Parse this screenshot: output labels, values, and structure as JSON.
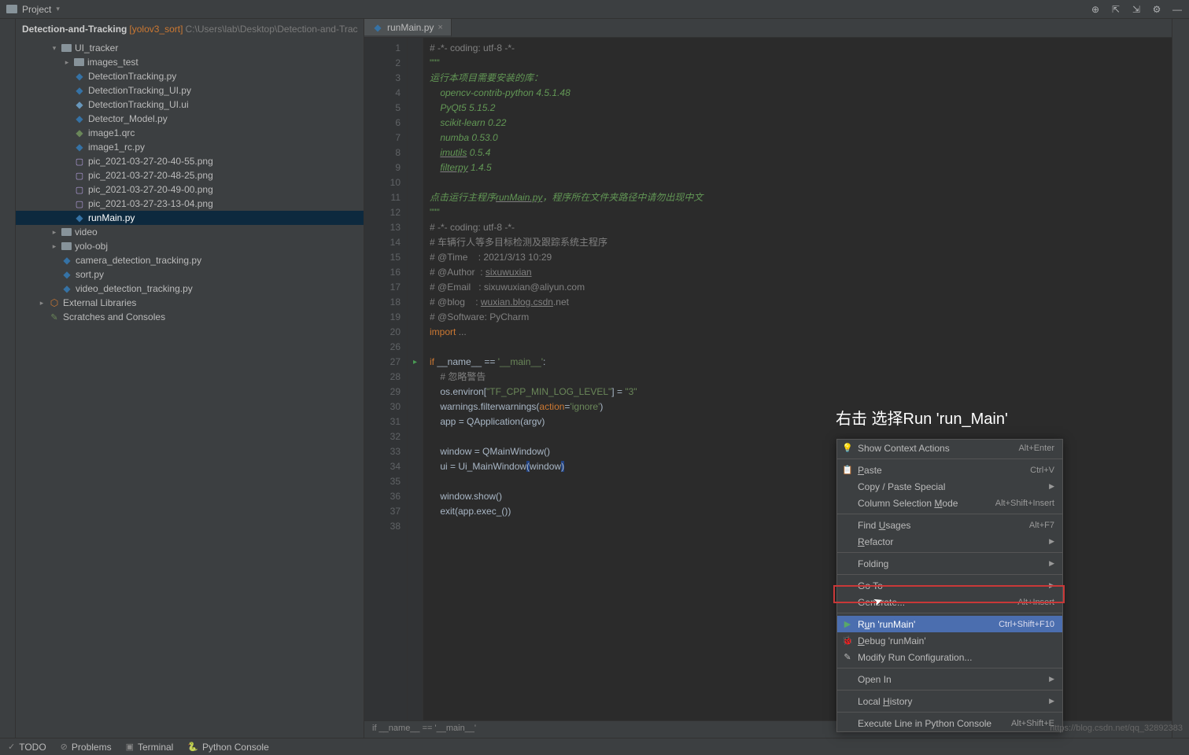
{
  "toolbar": {
    "project_label": "Project",
    "dropdown_arrow": "▾"
  },
  "breadcrumb": {
    "project": "Detection-and-Tracking",
    "branch": "[yolov3_sort]",
    "path": "C:\\Users\\lab\\Desktop\\Detection-and-Trac"
  },
  "tree": [
    {
      "indent": 0,
      "arrow": "▾",
      "icon": "folder",
      "label": "UI_tracker"
    },
    {
      "indent": 1,
      "arrow": "▸",
      "icon": "folder",
      "label": "images_test"
    },
    {
      "indent": 1,
      "arrow": "",
      "icon": "py",
      "label": "DetectionTracking.py"
    },
    {
      "indent": 1,
      "arrow": "",
      "icon": "py",
      "label": "DetectionTracking_UI.py"
    },
    {
      "indent": 1,
      "arrow": "",
      "icon": "ui",
      "label": "DetectionTracking_UI.ui"
    },
    {
      "indent": 1,
      "arrow": "",
      "icon": "py",
      "label": "Detector_Model.py"
    },
    {
      "indent": 1,
      "arrow": "",
      "icon": "qrc",
      "label": "image1.qrc"
    },
    {
      "indent": 1,
      "arrow": "",
      "icon": "py",
      "label": "image1_rc.py"
    },
    {
      "indent": 1,
      "arrow": "",
      "icon": "png",
      "label": "pic_2021-03-27-20-40-55.png"
    },
    {
      "indent": 1,
      "arrow": "",
      "icon": "png",
      "label": "pic_2021-03-27-20-48-25.png"
    },
    {
      "indent": 1,
      "arrow": "",
      "icon": "png",
      "label": "pic_2021-03-27-20-49-00.png"
    },
    {
      "indent": 1,
      "arrow": "",
      "icon": "png",
      "label": "pic_2021-03-27-23-13-04.png"
    },
    {
      "indent": 1,
      "arrow": "",
      "icon": "py",
      "label": "runMain.py",
      "selected": true
    },
    {
      "indent": 0,
      "arrow": "▸",
      "icon": "folder",
      "label": "video"
    },
    {
      "indent": 0,
      "arrow": "▸",
      "icon": "folder",
      "label": "yolo-obj"
    },
    {
      "indent": 0,
      "arrow": "",
      "icon": "py",
      "label": "camera_detection_tracking.py"
    },
    {
      "indent": 0,
      "arrow": "",
      "icon": "py",
      "label": "sort.py"
    },
    {
      "indent": 0,
      "arrow": "",
      "icon": "py",
      "label": "video_detection_tracking.py"
    },
    {
      "indent": -1,
      "arrow": "▸",
      "icon": "lib",
      "label": "External Libraries"
    },
    {
      "indent": -1,
      "arrow": "",
      "icon": "scratch",
      "label": "Scratches and Consoles"
    }
  ],
  "tab": {
    "name": "runMain.py"
  },
  "code": {
    "lines": [
      {
        "n": 1,
        "html": "<span class='c-comment'># -*- coding: utf-8 -*-</span>"
      },
      {
        "n": 2,
        "html": "<span class='docstr'>\"\"\"</span>"
      },
      {
        "n": 3,
        "html": "<span class='c-docline'>运行本项目需要安装的库：</span>"
      },
      {
        "n": 4,
        "html": "<span class='c-docline'>    opencv-contrib-python 4.5.1.48</span>"
      },
      {
        "n": 5,
        "html": "<span class='c-docline'>    PyQt5 5.15.2</span>"
      },
      {
        "n": 6,
        "html": "<span class='c-docline'>    scikit-learn 0.22</span>"
      },
      {
        "n": 7,
        "html": "<span class='c-docline'>    numba 0.53.0</span>"
      },
      {
        "n": 8,
        "html": "<span class='c-docline'>    <span class='c-under'>imutils</span> 0.5.4</span>"
      },
      {
        "n": 9,
        "html": "<span class='c-docline'>    <span class='c-under'>filterpy</span> 1.4.5</span>"
      },
      {
        "n": 10,
        "html": ""
      },
      {
        "n": 11,
        "html": "<span class='c-docline'>点击运行主程序<span class='c-under'>runMain.py</span>，程序所在文件夹路径中请勿出现中文</span>"
      },
      {
        "n": 12,
        "html": "<span class='docstr'>\"\"\"</span>"
      },
      {
        "n": 13,
        "html": "<span class='c-comment'># -*- coding: utf-8 -*-</span>"
      },
      {
        "n": 14,
        "html": "<span class='c-comment'># 车辆行人等多目标检测及跟踪系统主程序</span>"
      },
      {
        "n": 15,
        "html": "<span class='c-comment'># @Time    : 2021/3/13 10:29</span>"
      },
      {
        "n": 16,
        "html": "<span class='c-comment'># @Author  : <span class='c-under'>sixuwuxian</span></span>"
      },
      {
        "n": 17,
        "html": "<span class='c-comment'># @Email   : sixuwuxian@aliyun.com</span>"
      },
      {
        "n": 18,
        "html": "<span class='c-comment'># @blog    : <span class='c-under'>wuxian.blog.csdn</span>.net</span>"
      },
      {
        "n": 19,
        "html": "<span class='c-comment'># @Software: PyCharm</span>"
      },
      {
        "n": 20,
        "html": "<span class='c-keyword'>import </span><span class='c-comment'>...</span>"
      },
      {
        "n": 26,
        "html": ""
      },
      {
        "n": 27,
        "mark": "▸",
        "html": "<span class='c-keyword'>if</span> __name__ == <span class='c-string'>'__main__'</span>:"
      },
      {
        "n": 28,
        "html": "    <span class='c-comment'># 忽略警告</span>"
      },
      {
        "n": 29,
        "html": "    os.environ[<span class='c-string'>\"TF_CPP_MIN_LOG_LEVEL\"</span>] = <span class='c-string'>\"3\"</span>"
      },
      {
        "n": 30,
        "html": "    warnings.filterwarnings(<span class='c-keyword'>action</span>=<span class='c-string'>'ignore'</span>)"
      },
      {
        "n": 31,
        "html": "    app = QApplication(argv)"
      },
      {
        "n": 32,
        "html": ""
      },
      {
        "n": 33,
        "html": "    window = QMainWindow()"
      },
      {
        "n": 34,
        "html": "    ui = Ui_MainWindow<span class='caret-hl'>(</span>window<span class='caret-hl'>)</span>"
      },
      {
        "n": 35,
        "html": ""
      },
      {
        "n": 36,
        "html": "    window.show()"
      },
      {
        "n": 37,
        "html": "    exit(app.exec_())"
      },
      {
        "n": 38,
        "html": ""
      }
    ]
  },
  "bottom_breadcrumb": "if __name__ == '__main__'",
  "context_menu": [
    {
      "icon": "💡",
      "label": "Show Context Actions",
      "shortcut": "Alt+Enter"
    },
    {
      "sep": true
    },
    {
      "icon": "📋",
      "label": "Paste",
      "mnemonic": "P",
      "shortcut": "Ctrl+V"
    },
    {
      "label": "Copy / Paste Special",
      "submenu": true
    },
    {
      "label": "Column Selection Mode",
      "mnemonic": "M",
      "shortcut": "Alt+Shift+Insert"
    },
    {
      "sep": true
    },
    {
      "label": "Find Usages",
      "mnemonic": "U",
      "shortcut": "Alt+F7"
    },
    {
      "label": "Refactor",
      "mnemonic": "R",
      "submenu": true
    },
    {
      "sep": true
    },
    {
      "label": "Folding",
      "submenu": true
    },
    {
      "sep": true
    },
    {
      "label": "Go To",
      "submenu": true
    },
    {
      "label": "Generate...",
      "shortcut": "Alt+Insert"
    },
    {
      "sep": true
    },
    {
      "icon": "▶",
      "iconColor": "#59a869",
      "label": "Run 'runMain'",
      "mnemonic": "u",
      "shortcut": "Ctrl+Shift+F10",
      "highlighted": true
    },
    {
      "icon": "🐞",
      "iconColor": "#59a869",
      "label": "Debug 'runMain'",
      "mnemonic": "D"
    },
    {
      "icon": "✎",
      "label": "Modify Run Configuration..."
    },
    {
      "sep": true
    },
    {
      "label": "Open In",
      "submenu": true
    },
    {
      "sep": true
    },
    {
      "label": "Local History",
      "mnemonic": "H",
      "submenu": true
    },
    {
      "sep": true
    },
    {
      "label": "Execute Line in Python Console",
      "shortcut": "Alt+Shift+E"
    }
  ],
  "annotation": "右击 选择Run 'run_Main'",
  "watermark": "https://blog.csdn.net/qq_32892383",
  "statusbar": {
    "todo": "TODO",
    "problems": "Problems",
    "terminal": "Terminal",
    "pyconsole": "Python Console"
  }
}
